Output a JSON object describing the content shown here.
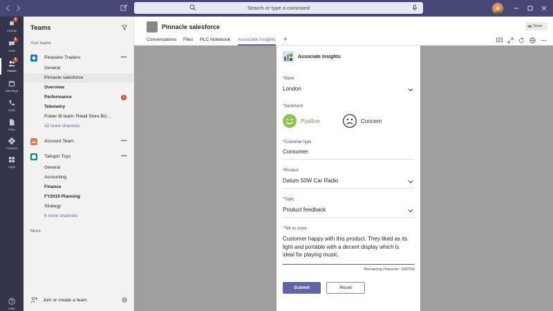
{
  "titlebar": {
    "search_placeholder": "Search or type a command",
    "colors": {
      "bar": "#464775"
    }
  },
  "appbar": {
    "items": [
      {
        "label": "Activity",
        "icon": "bell-icon",
        "badge": "2"
      },
      {
        "label": "Chat",
        "icon": "chat-icon",
        "badge": "1"
      },
      {
        "label": "Teams",
        "icon": "teams-icon",
        "badge": "1",
        "active": true
      },
      {
        "label": "Meetings",
        "icon": "calendar-icon"
      },
      {
        "label": "Calls",
        "icon": "phone-icon"
      },
      {
        "label": "Files",
        "icon": "file-icon"
      },
      {
        "label": "Costoso",
        "icon": "flower-icon"
      },
      {
        "label": "Apps",
        "icon": "apps-grid-icon"
      }
    ],
    "help_label": "Help"
  },
  "teams_panel": {
    "title": "Teams",
    "section_label": "Your teams",
    "teams": [
      {
        "name": "Pineview Traders",
        "color": "#0078d4",
        "channels": [
          {
            "name": "General"
          },
          {
            "name": "Pinnacle salesforce",
            "selected": true
          },
          {
            "name": "Overview",
            "bold": true
          },
          {
            "name": "Performance",
            "bold": true,
            "badge": "1"
          },
          {
            "name": "Telemetry",
            "bold": true
          },
          {
            "name": "Power Bi team: Retail Store Biz..."
          },
          {
            "name": "32 more channels",
            "link": true
          }
        ]
      },
      {
        "name": "Account Team",
        "color": "#e97548",
        "channels": []
      },
      {
        "name": "Tailspin Toys",
        "color": "#038387",
        "channels": [
          {
            "name": "General"
          },
          {
            "name": "Accounting"
          },
          {
            "name": "Finance",
            "bold": true
          },
          {
            "name": "FY2019 Planning",
            "bold": true
          },
          {
            "name": "Strategy"
          },
          {
            "name": "6 more channels",
            "link": true
          }
        ]
      }
    ],
    "more_label": "More",
    "join_label": "Join or create a team"
  },
  "channel_header": {
    "title": "Pinnacle salesforce",
    "team_badge": "Team",
    "tabs": [
      {
        "label": "Conversations"
      },
      {
        "label": "Files"
      },
      {
        "label": "PLC Notebook"
      },
      {
        "label": "Associate Insights",
        "active": true
      }
    ]
  },
  "card": {
    "title": "Associate Insights",
    "store": {
      "label": "*Store",
      "value": "London"
    },
    "sentiment": {
      "label": "*Sentiment",
      "positive": "Positive",
      "concern": "Concern",
      "positive_color": "#5ca82c"
    },
    "customer_type": {
      "label": "*Customer type",
      "value": "Consumer"
    },
    "product": {
      "label": "*Product",
      "value": "Datum 50W Car Radio"
    },
    "topic": {
      "label": "*Topic",
      "value": "Product feedback"
    },
    "tell_us": {
      "label": "*Tell us more",
      "value": "Customer happy with this product. They liked as its light and portable with a decent display which is ideal for playing music."
    },
    "remaining": "Remaining character: 150/250",
    "submit_label": "Submit",
    "reset_label": "Reset",
    "accent": "#6264a7"
  }
}
